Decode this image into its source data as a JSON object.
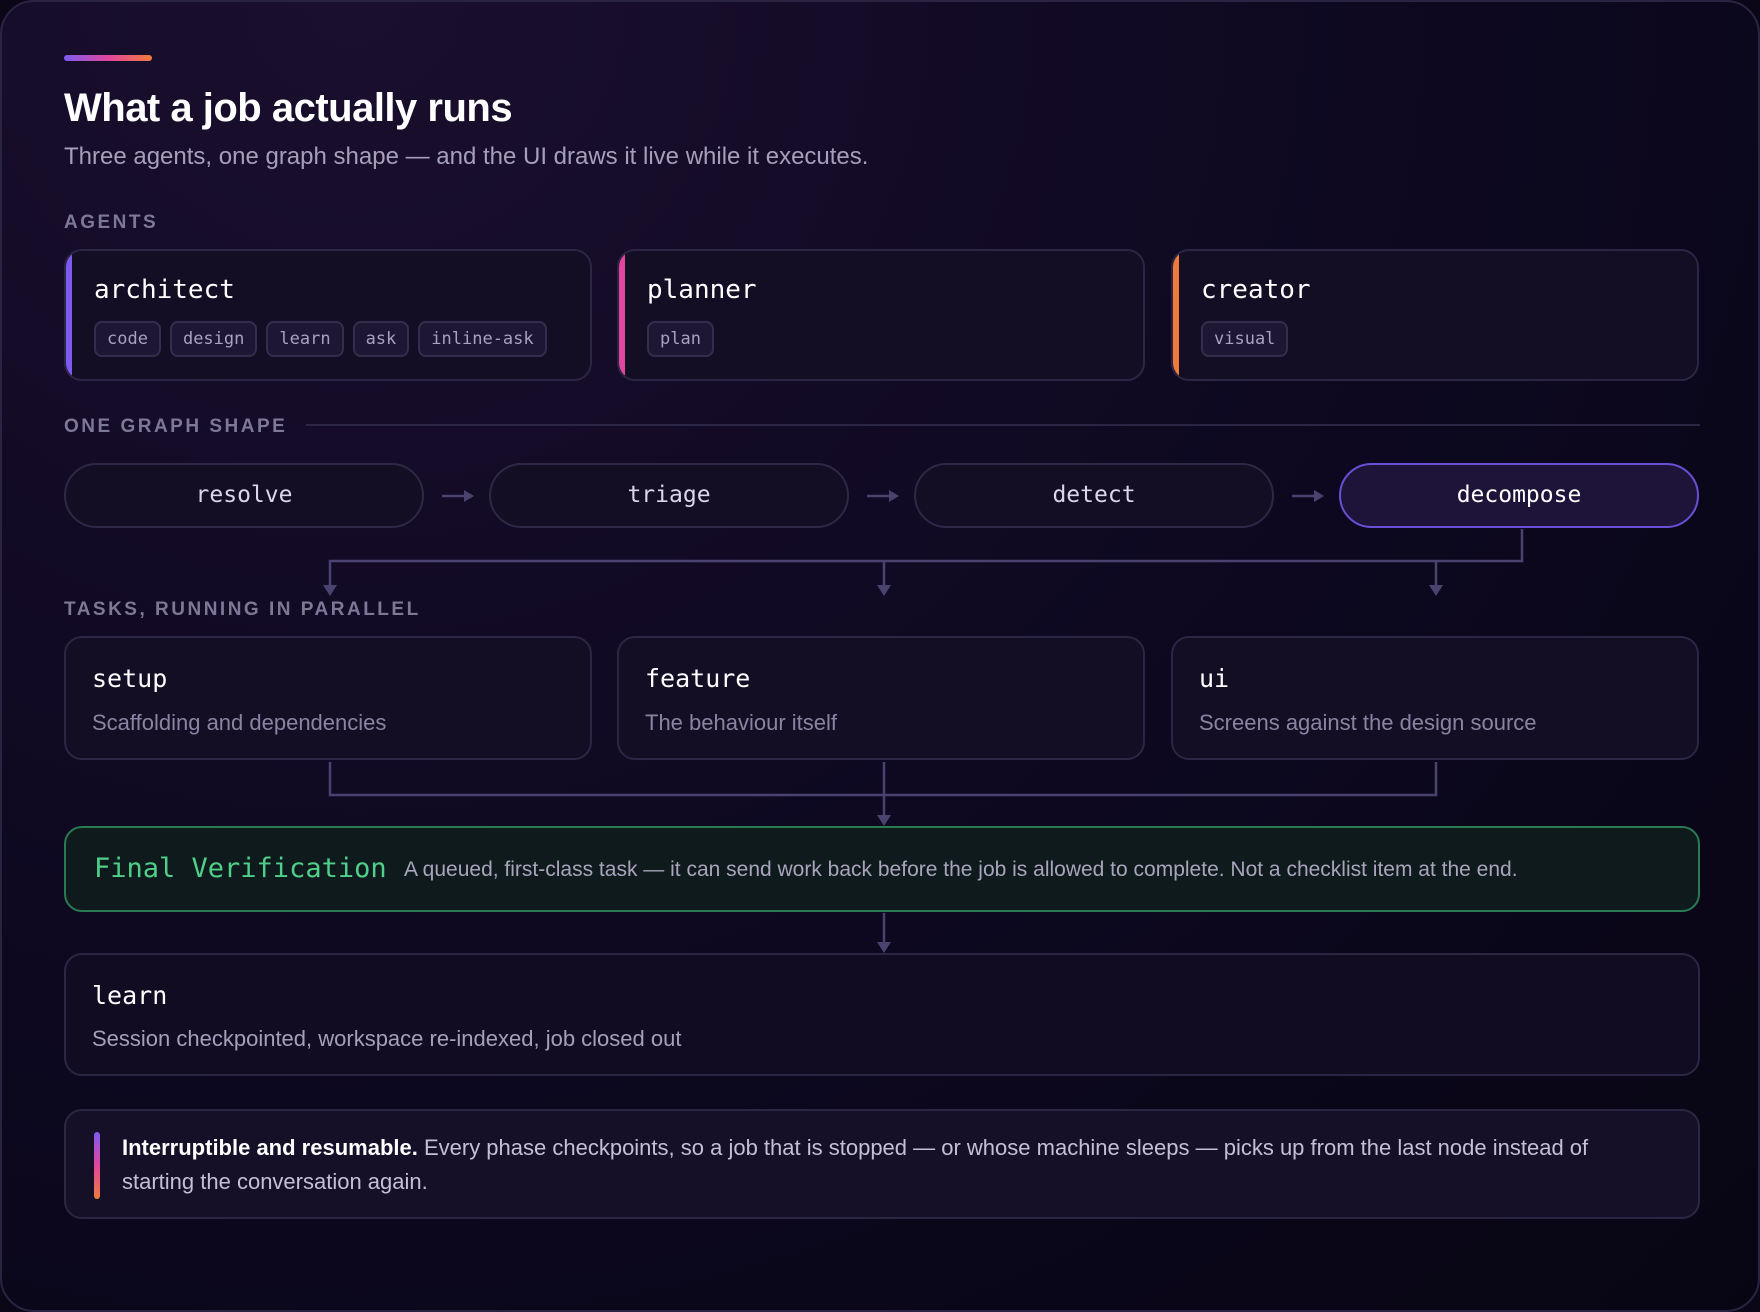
{
  "header": {
    "title": "What a job actually runs",
    "subtitle": "Three agents, one graph shape — and the UI draws it live while it executes."
  },
  "sections": {
    "agents": "AGENTS",
    "graph": "ONE GRAPH SHAPE",
    "tasks": "TASKS, RUNNING IN PARALLEL"
  },
  "agents": [
    {
      "name": "architect",
      "color": "#7d5bf0",
      "chips": [
        "code",
        "design",
        "learn",
        "ask",
        "inline-ask"
      ]
    },
    {
      "name": "planner",
      "color": "#e0469e",
      "chips": [
        "plan"
      ]
    },
    {
      "name": "creator",
      "color": "#f07a3a",
      "chips": [
        "visual"
      ]
    }
  ],
  "graph": {
    "nodes": [
      "resolve",
      "triage",
      "detect",
      "decompose"
    ],
    "active": "decompose"
  },
  "tasks": [
    {
      "name": "setup",
      "desc": "Scaffolding and dependencies"
    },
    {
      "name": "feature",
      "desc": "The behaviour itself"
    },
    {
      "name": "ui",
      "desc": "Screens against the design source"
    }
  ],
  "final": {
    "name": "Final Verification",
    "desc": "A queued, first-class task — it can send work back before the job is allowed to complete. Not a checklist item at the end."
  },
  "learn": {
    "name": "learn",
    "desc": "Session checkpointed, workspace re-indexed, job closed out"
  },
  "note": {
    "bold": "Interruptible and resumable.",
    "text": " Every phase checkpoints, so a job that is stopped — or whose machine sleeps — picks up from the last node instead of starting the conversation again."
  },
  "colors": {
    "accent_purple": "#7d5bf0",
    "accent_pink": "#e0469e",
    "accent_orange": "#f07a3a",
    "verify_green": "#4fd08a"
  }
}
